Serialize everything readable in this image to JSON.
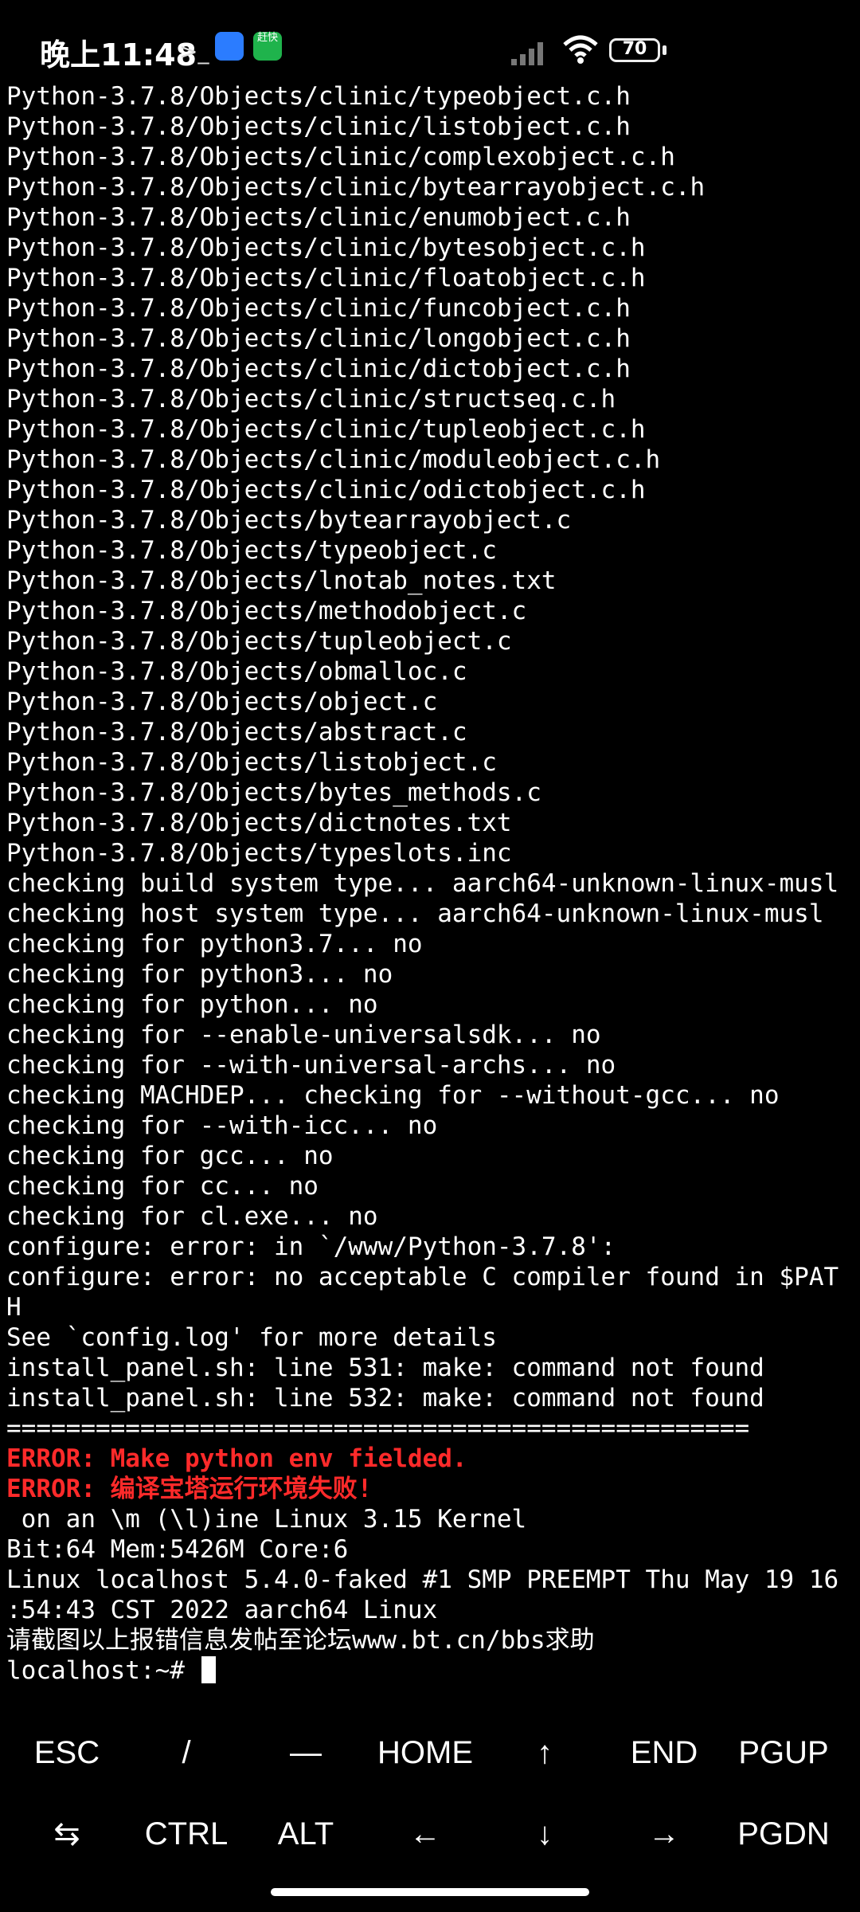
{
  "status": {
    "time": "晚上11:48",
    "terminal_glyph": ">_",
    "app_badge_b": "赶快",
    "battery": "70"
  },
  "terminal": {
    "lines": [
      "Python-3.7.8/Objects/clinic/typeobject.c.h",
      "Python-3.7.8/Objects/clinic/listobject.c.h",
      "Python-3.7.8/Objects/clinic/complexobject.c.h",
      "Python-3.7.8/Objects/clinic/bytearrayobject.c.h",
      "Python-3.7.8/Objects/clinic/enumobject.c.h",
      "Python-3.7.8/Objects/clinic/bytesobject.c.h",
      "Python-3.7.8/Objects/clinic/floatobject.c.h",
      "Python-3.7.8/Objects/clinic/funcobject.c.h",
      "Python-3.7.8/Objects/clinic/longobject.c.h",
      "Python-3.7.8/Objects/clinic/dictobject.c.h",
      "Python-3.7.8/Objects/clinic/structseq.c.h",
      "Python-3.7.8/Objects/clinic/tupleobject.c.h",
      "Python-3.7.8/Objects/clinic/moduleobject.c.h",
      "Python-3.7.8/Objects/clinic/odictobject.c.h",
      "Python-3.7.8/Objects/bytearrayobject.c",
      "Python-3.7.8/Objects/typeobject.c",
      "Python-3.7.8/Objects/lnotab_notes.txt",
      "Python-3.7.8/Objects/methodobject.c",
      "Python-3.7.8/Objects/tupleobject.c",
      "Python-3.7.8/Objects/obmalloc.c",
      "Python-3.7.8/Objects/object.c",
      "Python-3.7.8/Objects/abstract.c",
      "Python-3.7.8/Objects/listobject.c",
      "Python-3.7.8/Objects/bytes_methods.c",
      "Python-3.7.8/Objects/dictnotes.txt",
      "Python-3.7.8/Objects/typeslots.inc",
      "checking build system type... aarch64-unknown-linux-musl",
      "checking host system type... aarch64-unknown-linux-musl",
      "checking for python3.7... no",
      "checking for python3... no",
      "checking for python... no",
      "checking for --enable-universalsdk... no",
      "checking for --with-universal-archs... no",
      "checking MACHDEP... checking for --without-gcc... no",
      "checking for --with-icc... no",
      "checking for gcc... no",
      "checking for cc... no",
      "checking for cl.exe... no",
      "configure: error: in `/www/Python-3.7.8':",
      "configure: error: no acceptable C compiler found in $PAT",
      "H",
      "See `config.log' for more details",
      "install_panel.sh: line 531: make: command not found",
      "install_panel.sh: line 532: make: command not found",
      "=================================================="
    ],
    "errors": [
      "ERROR: Make python env fielded.",
      "ERROR: 编译宝塔运行环境失败!"
    ],
    "after": [
      " on an \\m (\\l)ine Linux 3.15 Kernel",
      "Bit:64 Mem:5426M Core:6",
      "Linux localhost 5.4.0-faked #1 SMP PREEMPT Thu May 19 16",
      ":54:43 CST 2022 aarch64 Linux",
      "请截图以上报错信息发帖至论坛www.bt.cn/bbs求助"
    ],
    "prompt": "localhost:~# "
  },
  "keys": {
    "row1": [
      "ESC",
      "/",
      "—",
      "HOME",
      "↑",
      "END",
      "PGUP"
    ],
    "row2": [
      "⇆",
      "CTRL",
      "ALT",
      "←",
      "↓",
      "→",
      "PGDN"
    ]
  }
}
